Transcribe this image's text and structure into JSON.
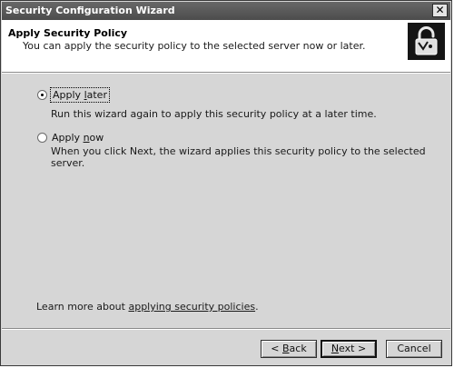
{
  "window": {
    "title": "Security Configuration Wizard",
    "close_glyph": "✕"
  },
  "header": {
    "title": "Apply Security Policy",
    "subtitle": "You can apply the security policy to the selected server now or later.",
    "icon": "lock-icon"
  },
  "options": [
    {
      "label_pre": "Apply ",
      "label_ul": "l",
      "label_post": "ater",
      "checked": true,
      "description": "Run this wizard again to apply this security policy at a later time."
    },
    {
      "label_pre": "Apply ",
      "label_ul": "n",
      "label_post": "ow",
      "checked": false,
      "description": "When you click Next, the wizard applies this security policy to the selected server."
    }
  ],
  "learn_more": {
    "prefix": "Learn more about ",
    "link": "applying security policies",
    "suffix": "."
  },
  "buttons": {
    "back_pre": "< ",
    "back_ul": "B",
    "back_post": "ack",
    "next_ul": "N",
    "next_post": "ext >",
    "cancel": "Cancel"
  }
}
